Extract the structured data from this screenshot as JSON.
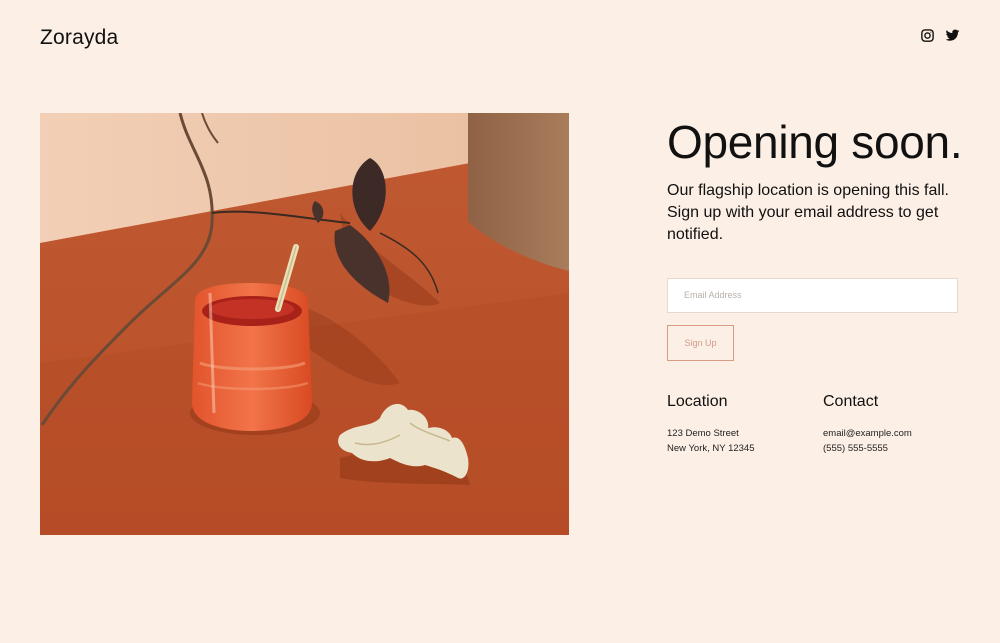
{
  "brand": {
    "name": "Zorayda"
  },
  "social": [
    {
      "icon": "instagram-icon"
    },
    {
      "icon": "twitter-icon"
    }
  ],
  "hero": {
    "headline": "Opening soon.",
    "description": "Our flagship location is opening this fall. Sign up with your email address to get notified."
  },
  "signup": {
    "placeholder": "Email Address",
    "value": "",
    "button_label": "Sign Up"
  },
  "location": {
    "heading": "Location",
    "address_line1": "123 Demo Street",
    "address_line2": "New York, NY 12345"
  },
  "contact": {
    "heading": "Contact",
    "email": "email@example.com",
    "phone": "(555) 555-5555"
  },
  "colors": {
    "background": "#fcefe5",
    "accent": "#d99a86",
    "text": "#111111"
  }
}
